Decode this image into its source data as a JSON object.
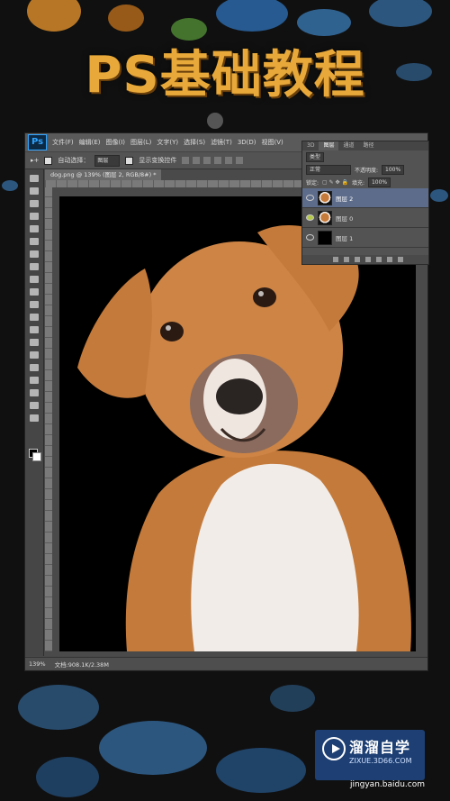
{
  "banner": {
    "title": "PS基础教程"
  },
  "photoshop": {
    "logo": "Ps",
    "menu": [
      "文件(F)",
      "编辑(E)",
      "图像(I)",
      "图层(L)",
      "文字(Y)",
      "选择(S)",
      "滤镜(T)",
      "3D(D)",
      "视图(V)"
    ],
    "options": {
      "auto_select_label": "自动选择：",
      "auto_select_value": "图层",
      "show_transform_label": "显示变换控件"
    },
    "document_tab": "dog.png @ 139% (图层 2, RGB/8#) *",
    "status": {
      "zoom": "139%",
      "doc_size": "文档:908.1K/2.38M"
    },
    "tools": [
      "move-icon",
      "marquee-icon",
      "lasso-icon",
      "quick-select-icon",
      "crop-icon",
      "eyedropper-icon",
      "healing-icon",
      "brush-icon",
      "stamp-icon",
      "history-brush-icon",
      "eraser-icon",
      "gradient-icon",
      "blur-icon",
      "dodge-icon",
      "pen-icon",
      "type-icon",
      "path-select-icon",
      "shape-icon",
      "hand-icon",
      "zoom-icon"
    ]
  },
  "layers_panel": {
    "tabs": [
      "3D",
      "图层",
      "通道",
      "路径"
    ],
    "filter_label": "类型",
    "blend_mode": "正常",
    "opacity_label": "不透明度:",
    "opacity_value": "100%",
    "lock_label": "锁定:",
    "fill_label": "填充:",
    "fill_value": "100%",
    "layers": [
      {
        "name": "图层 2",
        "selected": true
      },
      {
        "name": "图层 0",
        "selected": false
      },
      {
        "name": "图层 1",
        "selected": false
      }
    ]
  },
  "watermark": {
    "name": "溜溜自学",
    "url": "ZIXUE.3D66.COM",
    "source": "jingyan.baidu.com"
  },
  "colors": {
    "title": "#e8a93a",
    "watermark_bg": "#1d3f73",
    "selected_layer": "#5d6c8a"
  }
}
